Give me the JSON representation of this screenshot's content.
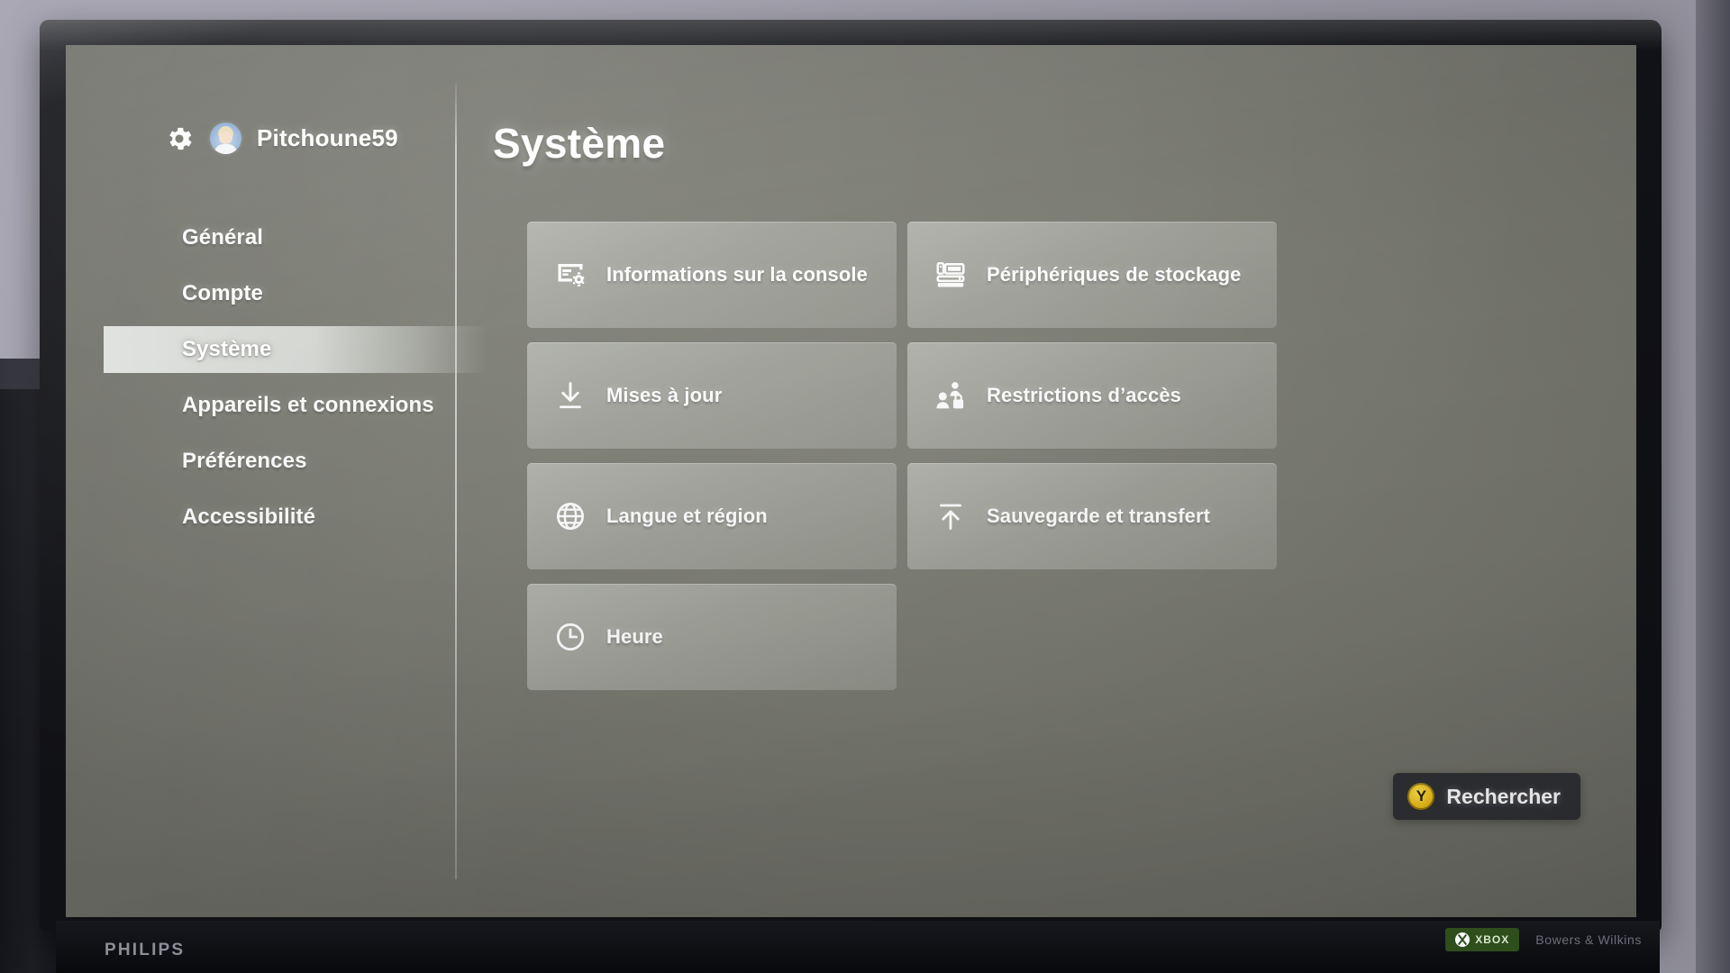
{
  "device": {
    "tv_brand": "PHILIPS",
    "audio_brand": "Bowers & Wilkins",
    "console_badge": "XBOX"
  },
  "account": {
    "gamertag": "Pitchoune59",
    "gear_icon": "gear-icon",
    "avatar_icon": "avatar"
  },
  "sidebar": {
    "items": [
      {
        "label": "Général",
        "selected": false
      },
      {
        "label": "Compte",
        "selected": false
      },
      {
        "label": "Système",
        "selected": true
      },
      {
        "label": "Appareils et connexions",
        "selected": false
      },
      {
        "label": "Préférences",
        "selected": false
      },
      {
        "label": "Accessibilité",
        "selected": false
      }
    ]
  },
  "main": {
    "title": "Système",
    "tiles": [
      {
        "label": "Informations sur la console",
        "icon": "console-info-icon"
      },
      {
        "label": "Périphériques de stockage",
        "icon": "storage-device-icon"
      },
      {
        "label": "Mises à jour",
        "icon": "download-icon"
      },
      {
        "label": "Restrictions d’accès",
        "icon": "family-lock-icon"
      },
      {
        "label": "Langue et région",
        "icon": "globe-icon"
      },
      {
        "label": "Sauvegarde et transfert",
        "icon": "upload-icon"
      },
      {
        "label": "Heure",
        "icon": "clock-icon"
      }
    ]
  },
  "search": {
    "button_label": "Rechercher",
    "button_glyph": "Y",
    "accent_color": "#e8b710"
  },
  "colors": {
    "screen_bg": "#76776d",
    "tile_bg": "rgba(214,216,211,0.44)",
    "selection_bg": "#eef0ee",
    "text": "#fdfdfd",
    "search_bg": "#2f3034"
  }
}
